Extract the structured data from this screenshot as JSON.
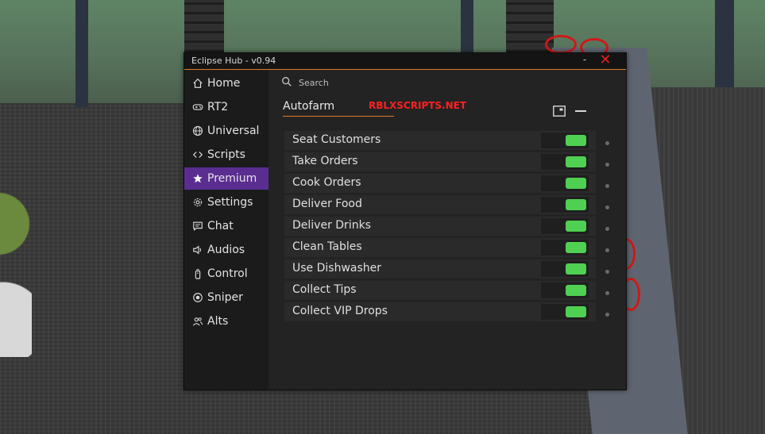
{
  "window": {
    "title": "Eclipse Hub - v0.94",
    "minimize": "-",
    "close": "✕",
    "accent": "#e07b29",
    "active_color": "#5a2d91"
  },
  "sidebar": {
    "items": [
      {
        "label": "Home",
        "icon": "home-icon",
        "active": false
      },
      {
        "label": "RT2",
        "icon": "gamepad-icon",
        "active": false
      },
      {
        "label": "Universal",
        "icon": "globe-icon",
        "active": false
      },
      {
        "label": "Scripts",
        "icon": "code-icon",
        "active": false
      },
      {
        "label": "Premium",
        "icon": "star-icon",
        "active": true
      },
      {
        "label": "Settings",
        "icon": "gear-icon",
        "active": false
      },
      {
        "label": "Chat",
        "icon": "chat-icon",
        "active": false
      },
      {
        "label": "Audios",
        "icon": "speaker-icon",
        "active": false
      },
      {
        "label": "Control",
        "icon": "remote-icon",
        "active": false
      },
      {
        "label": "Sniper",
        "icon": "target-icon",
        "active": false
      },
      {
        "label": "Alts",
        "icon": "users-icon",
        "active": false
      }
    ]
  },
  "search": {
    "placeholder": "Search"
  },
  "section": {
    "title": "Autofarm",
    "watermark": "RBLXSCRIPTS.NET"
  },
  "toggles": {
    "on_color": "#4fd052",
    "items": [
      {
        "label": "Seat Customers",
        "on": true
      },
      {
        "label": "Take Orders",
        "on": true
      },
      {
        "label": "Cook Orders",
        "on": true
      },
      {
        "label": "Deliver Food",
        "on": true
      },
      {
        "label": "Deliver Drinks",
        "on": true
      },
      {
        "label": "Clean Tables",
        "on": true
      },
      {
        "label": "Use Dishwasher",
        "on": true
      },
      {
        "label": "Collect Tips",
        "on": true
      },
      {
        "label": "Collect VIP Drops",
        "on": true
      }
    ]
  }
}
